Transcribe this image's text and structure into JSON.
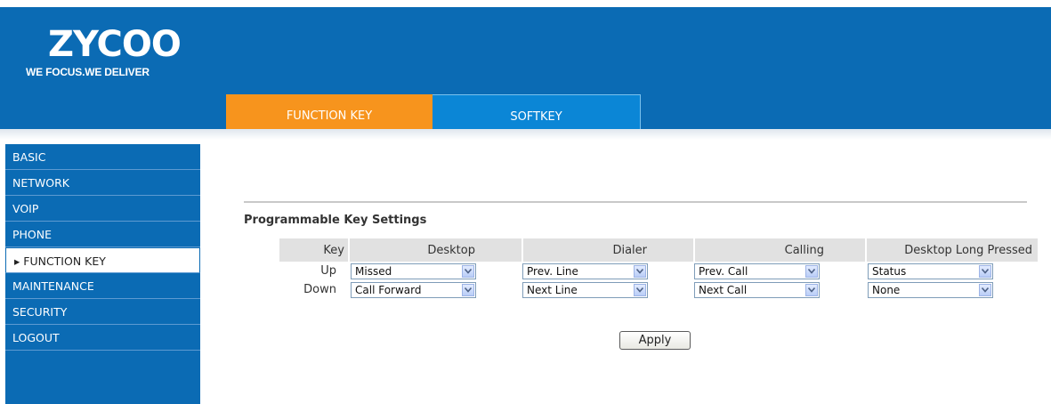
{
  "brand": {
    "logo_text": "ZYCOO",
    "tagline": "WE FOCUS.WE DELIVER"
  },
  "tabs": [
    {
      "label": "FUNCTION KEY",
      "active": true
    },
    {
      "label": "SOFTKEY",
      "active": false
    }
  ],
  "sidebar": {
    "items": [
      {
        "label": "BASIC"
      },
      {
        "label": "NETWORK"
      },
      {
        "label": "VOIP"
      },
      {
        "label": "PHONE"
      },
      {
        "label": "▸ FUNCTION KEY",
        "active": true
      },
      {
        "label": "MAINTENANCE"
      },
      {
        "label": "SECURITY"
      },
      {
        "label": "LOGOUT"
      }
    ]
  },
  "section": {
    "title": "Programmable Key Settings"
  },
  "table": {
    "headers": [
      "Key",
      "Desktop",
      "Dialer",
      "Calling",
      "Desktop Long Pressed"
    ],
    "rows": [
      {
        "key": "Up",
        "desktop": "Missed",
        "dialer": "Prev. Line",
        "calling": "Prev. Call",
        "long_pressed": "Status"
      },
      {
        "key": "Down",
        "desktop": "Call Forward",
        "dialer": "Next Line",
        "calling": "Next Call",
        "long_pressed": "None"
      }
    ]
  },
  "apply_label": "Apply",
  "colors": {
    "header_blue": "#0b6bb4",
    "active_tab_orange": "#f7941d",
    "inactive_tab_blue": "#0b86d6"
  }
}
